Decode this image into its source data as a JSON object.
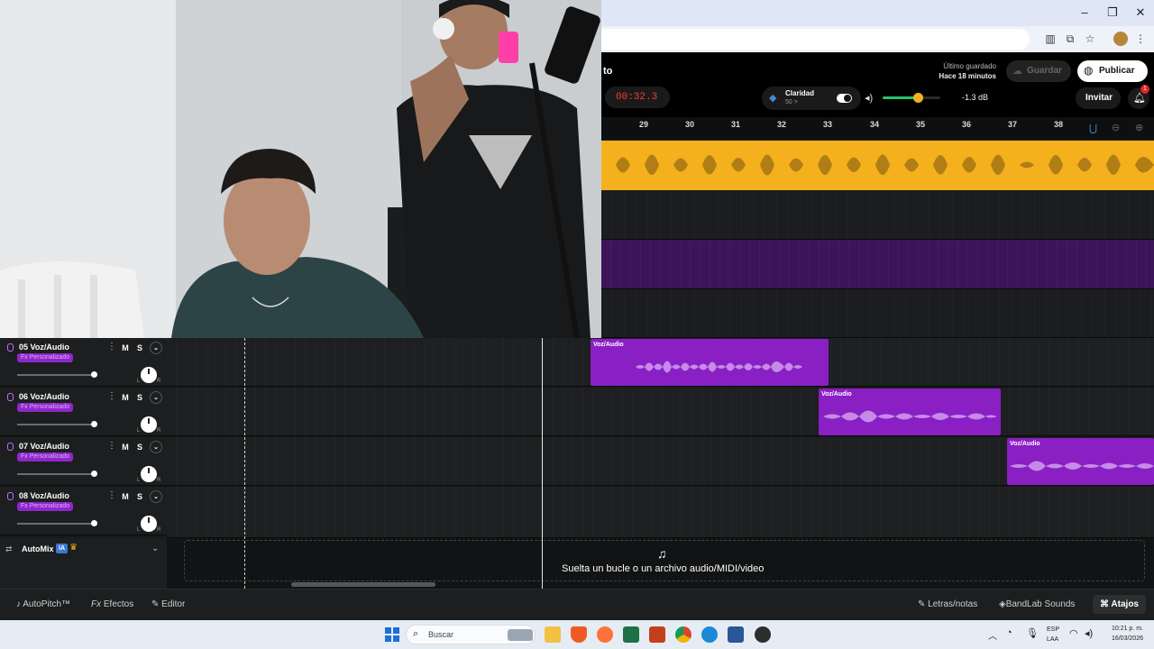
{
  "window": {
    "minimize_icon": "minimize-icon",
    "maximize_icon": "maximize-icon",
    "close_icon": "close-icon"
  },
  "header": {
    "project_title_fragment": "to",
    "last_saved_label": "Último guardado",
    "last_saved_value": "Hace 18 minutos",
    "save_label": "Guardar",
    "publish_label": "Publicar",
    "time": "00:32.3",
    "clarity_label": "Claridad",
    "clarity_value": "50 >",
    "volume_db": "-1.3 dB",
    "invite_label": "Invitar",
    "notification_count": "1",
    "colors": {
      "time_red": "#ff3b3b",
      "accent_yellow": "#f4b11d",
      "purple": "#8a1fc4"
    }
  },
  "ruler": {
    "ticks": [
      "29",
      "30",
      "31",
      "32",
      "33",
      "34",
      "35",
      "36",
      "37",
      "38"
    ]
  },
  "tracks": [
    {
      "number": "05",
      "name": "Voz/Audio",
      "fx": "Fx Personalizado",
      "mute": "M",
      "solo": "S",
      "region_label": "Voz/Audio"
    },
    {
      "number": "06",
      "name": "Voz/Audio",
      "fx": "Fx Personalizado",
      "mute": "M",
      "solo": "S",
      "region_label": "Voz/Audio"
    },
    {
      "number": "07",
      "name": "Voz/Audio",
      "fx": "Fx Personalizado",
      "mute": "M",
      "solo": "S",
      "region_label": "Voz/Audio"
    },
    {
      "number": "08",
      "name": "Voz/Audio",
      "fx": "Fx Personalizado",
      "mute": "M",
      "solo": "S",
      "region_label": ""
    }
  ],
  "automix": {
    "label": "AutoMix",
    "badge": "IA"
  },
  "dropzone": {
    "text": "Suelta un bucle o un archivo audio/MIDI/video"
  },
  "bottom_bar": {
    "autopitch": "AutoPitch™",
    "effects": "Efectos",
    "editor": "Editor",
    "lyrics": "Letras/notas",
    "sounds": "BandLab Sounds",
    "shortcuts": "Atajos"
  },
  "taskbar": {
    "search_placeholder": "Buscar",
    "lang_line1": "ESP",
    "lang_line2": "LAA",
    "clock_time": "10:21 p. m.",
    "clock_date": "16/03/2026"
  }
}
